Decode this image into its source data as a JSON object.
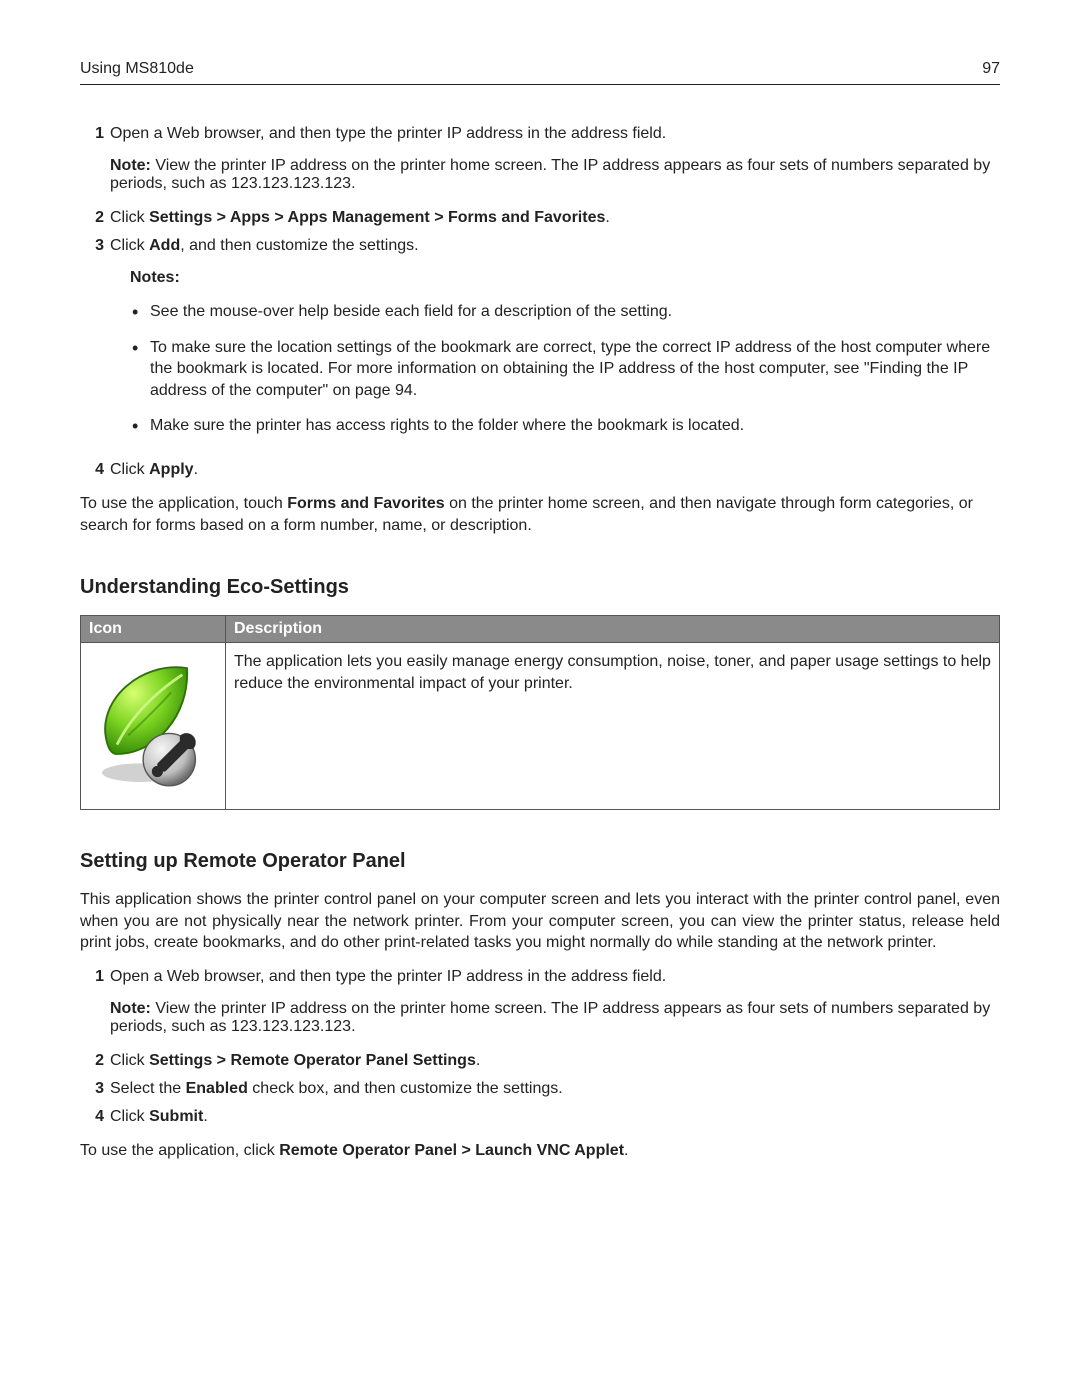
{
  "header": {
    "title": "Using MS810de",
    "page": "97"
  },
  "steps_a": {
    "1": {
      "text": "Open a Web browser, and then type the printer IP address in the address field.",
      "note": "View the printer IP address on the printer home screen. The IP address appears as four sets of numbers separated by periods, such as 123.123.123.123."
    },
    "2": {
      "pre": "Click ",
      "path": "Settings > Apps > Apps Management > Forms and Favorites",
      "post": "."
    },
    "3": {
      "pre": "Click ",
      "bold": "Add",
      "post": ", and then customize the settings."
    },
    "notes_label": "Notes:",
    "bullets": {
      "1": "See the mouse-over help beside each field for a description of the setting.",
      "2": "To make sure the location settings of the bookmark are correct, type the correct IP address of the host computer where the bookmark is located. For more information on obtaining the IP address of the host computer, see \"Finding the IP address of the computer\" on page 94.",
      "3": "Make sure the printer has access rights to the folder where the bookmark is located."
    },
    "4": {
      "pre": "Click ",
      "bold": "Apply",
      "post": "."
    }
  },
  "after_a": {
    "pre": "To use the application, touch ",
    "bold": "Forms and Favorites",
    "post": " on the printer home screen, and then navigate through form categories, or search for forms based on a form number, name, or description."
  },
  "eco": {
    "heading": "Understanding Eco-Settings",
    "th_icon": "Icon",
    "th_desc": "Description",
    "desc": "The application lets you easily manage energy consumption, noise, toner, and paper usage settings to help reduce the environmental impact of your printer.",
    "icon_name": "eco-leaf-wrench-icon"
  },
  "rop": {
    "heading": "Setting up Remote Operator Panel",
    "intro": "This application shows the printer control panel on your computer screen and lets you interact with the printer control panel, even when you are not physically near the network printer. From your computer screen, you can view the printer status, release held print jobs, create bookmarks, and do other print-related tasks you might normally do while standing at the network printer.",
    "steps": {
      "1": {
        "text": "Open a Web browser, and then type the printer IP address in the address field.",
        "note": "View the printer IP address on the printer home screen. The IP address appears as four sets of numbers separated by periods, such as 123.123.123.123."
      },
      "2": {
        "pre": "Click ",
        "path": "Settings > Remote Operator Panel Settings",
        "post": "."
      },
      "3": {
        "pre": "Select the ",
        "bold": "Enabled",
        "post": " check box, and then customize the settings."
      },
      "4": {
        "pre": "Click ",
        "bold": "Submit",
        "post": "."
      }
    },
    "after": {
      "pre": "To use the application, click ",
      "path": "Remote Operator Panel > Launch VNC Applet",
      "post": "."
    }
  },
  "labels": {
    "note": "Note:"
  }
}
